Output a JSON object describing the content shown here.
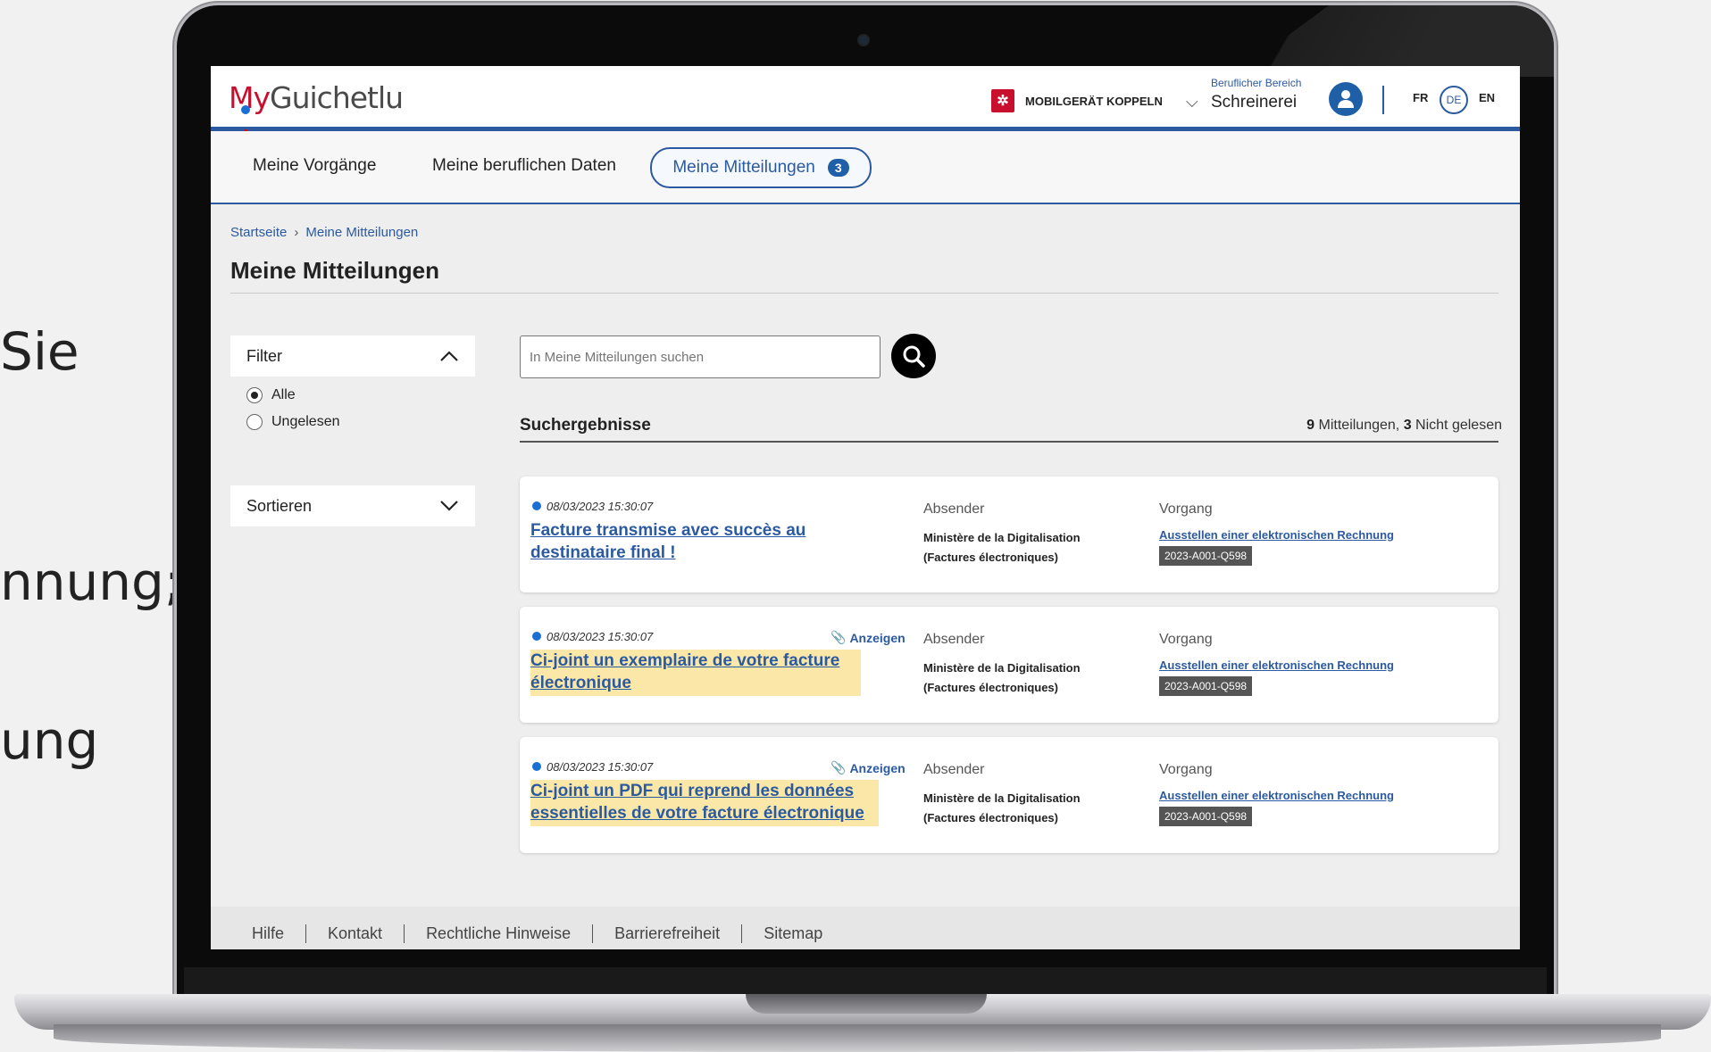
{
  "side_text": [
    "Sie",
    "nnung;",
    "ung"
  ],
  "header": {
    "logo_my": "My",
    "logo_rest": "Guichet",
    "logo_dot": ".",
    "logo_tld": "lu",
    "pair_device": "MOBILGERÄT KOPPELN",
    "area_label": "Beruflicher Bereich",
    "area_value": "Schreinerei",
    "languages": [
      "FR",
      "DE",
      "EN"
    ],
    "active_language": "DE"
  },
  "nav": {
    "items": [
      "Meine Vorgänge",
      "Meine beruflichen Daten"
    ],
    "active": "Meine Mitteilungen",
    "active_count": "3"
  },
  "breadcrumb": [
    "Startseite",
    "Meine Mitteilungen"
  ],
  "page_title": "Meine Mitteilungen",
  "filter": {
    "label": "Filter",
    "options": [
      "Alle",
      "Ungelesen"
    ],
    "selected": "Alle"
  },
  "sort": {
    "label": "Sortieren"
  },
  "search": {
    "placeholder": "In Meine Mitteilungen suchen"
  },
  "results": {
    "heading": "Suchergebnisse",
    "total": "9",
    "total_label": "Mitteilungen,",
    "unread": "3",
    "unread_label": "Nicht gelesen"
  },
  "messages": [
    {
      "date": "08/03/2023 15:30:07",
      "subject": "Facture transmise avec succès au destinataire final !",
      "attachment": "",
      "sender_label": "Absender",
      "sender": "Ministère de la Digitalisation (Factures électroniques)",
      "procedure_label": "Vorgang",
      "procedure": "Ausstellen einer elektronischen Rechnung",
      "procedure_id": "2023-A001-Q598"
    },
    {
      "date": "08/03/2023 15:30:07",
      "subject": "Ci-joint un exemplaire de votre facture électronique",
      "attachment": "Anzeigen",
      "sender_label": "Absender",
      "sender": "Ministère de la Digitalisation (Factures électroniques)",
      "procedure_label": "Vorgang",
      "procedure": "Ausstellen einer elektronischen Rechnung",
      "procedure_id": "2023-A001-Q598"
    },
    {
      "date": "08/03/2023 15:30:07",
      "subject": "Ci-joint un PDF qui reprend les données essentielles de votre facture électronique",
      "attachment": "Anzeigen",
      "sender_label": "Absender",
      "sender": "Ministère de la Digitalisation (Factures électroniques)",
      "procedure_label": "Vorgang",
      "procedure": "Ausstellen einer elektronischen Rechnung",
      "procedure_id": "2023-A001-Q598"
    }
  ],
  "footer": [
    "Hilfe",
    "Kontakt",
    "Rechtliche Hinweise",
    "Barrierefreiheit",
    "Sitemap"
  ],
  "colors": {
    "brand_red": "#c8102e",
    "brand_blue": "#2b5aa0",
    "highlight": "#fbe7a8",
    "unread_dot": "#1a6fd4"
  }
}
